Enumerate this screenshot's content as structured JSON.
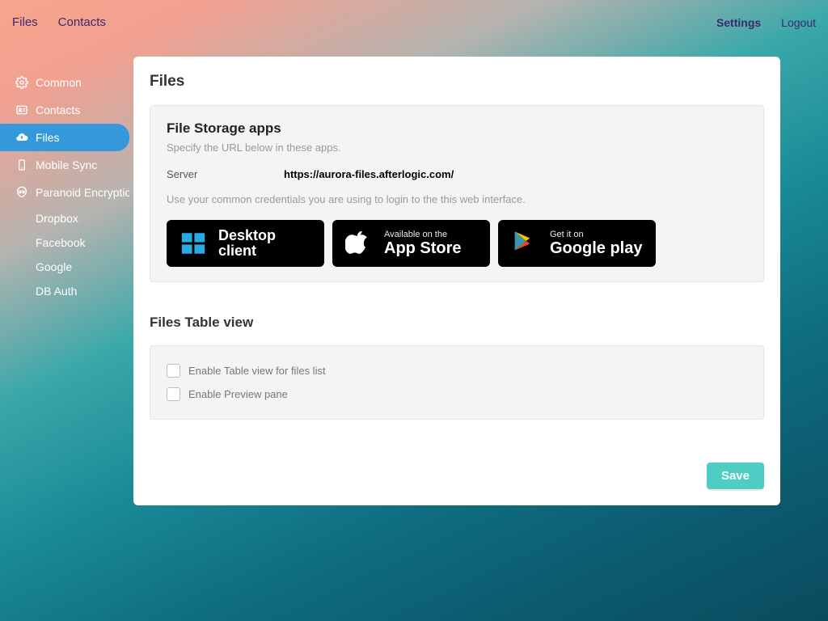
{
  "topbar": {
    "tabs": [
      "Files",
      "Contacts"
    ],
    "settings": "Settings",
    "logout": "Logout"
  },
  "sidebar": {
    "items": [
      {
        "label": "Common",
        "icon": "gear-icon"
      },
      {
        "label": "Contacts",
        "icon": "card-icon"
      },
      {
        "label": "Files",
        "icon": "cloud-icon",
        "active": true
      },
      {
        "label": "Mobile Sync",
        "icon": "mobile-icon"
      },
      {
        "label": "Paranoid Encryption",
        "icon": "alien-icon"
      }
    ],
    "subitems": [
      "Dropbox",
      "Facebook",
      "Google",
      "DB Auth"
    ]
  },
  "main": {
    "title": "Files",
    "storage": {
      "heading": "File Storage apps",
      "desc": "Specify the URL below in these apps.",
      "server_label": "Server",
      "server_value": "https://aurora-files.afterlogic.com/",
      "note": "Use your common credentials you are using to login to the this web interface.",
      "badges": {
        "desktop": {
          "line1": "Desktop",
          "line2": "client"
        },
        "appstore": {
          "small": "Available on the",
          "big": "App Store"
        },
        "play": {
          "small": "Get it on",
          "big": "Google play"
        }
      }
    },
    "tableview": {
      "heading": "Files Table view",
      "opt1": "Enable Table view for files list",
      "opt2": "Enable Preview pane"
    },
    "save": "Save"
  }
}
